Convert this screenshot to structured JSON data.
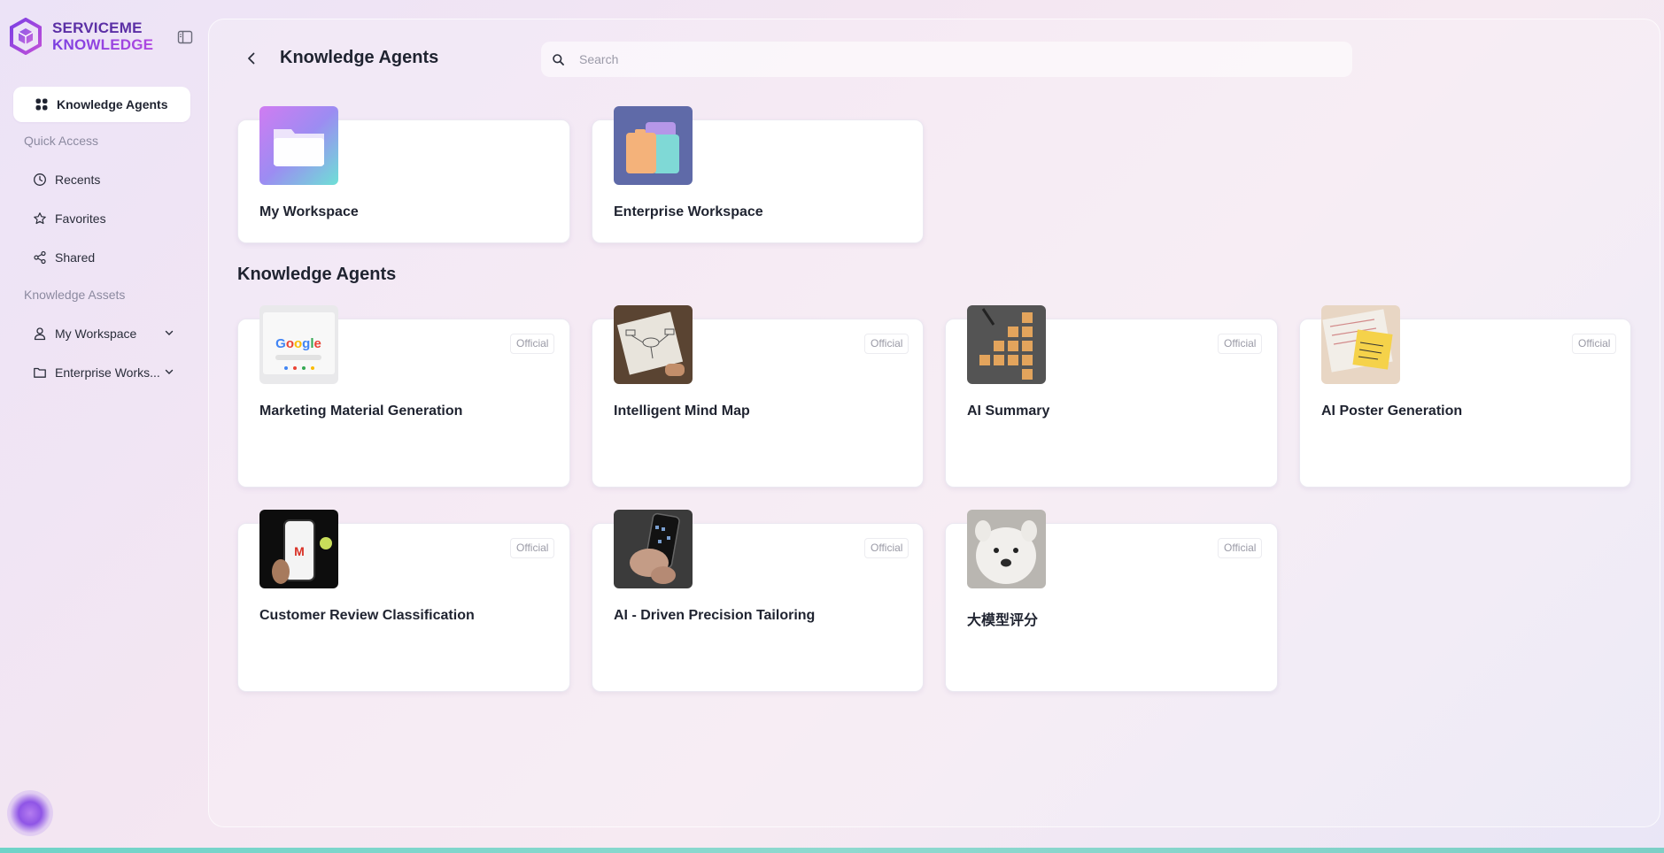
{
  "brand": {
    "line1": "SERVICEME",
    "line2": "KNOWLEDGE"
  },
  "sidebar": {
    "active": {
      "label": "Knowledge Agents",
      "icon": "grid-icon"
    },
    "quick_access_title": "Quick Access",
    "quick_access": [
      {
        "label": "Recents",
        "icon": "clock-icon"
      },
      {
        "label": "Favorites",
        "icon": "star-icon"
      },
      {
        "label": "Shared",
        "icon": "share-icon"
      }
    ],
    "assets_title": "Knowledge Assets",
    "assets": [
      {
        "label": "My Workspace",
        "icon": "user-icon"
      },
      {
        "label": "Enterprise Works...",
        "icon": "folder-icon"
      }
    ]
  },
  "header": {
    "title": "Knowledge Agents",
    "search_placeholder": "Search"
  },
  "workspaces": [
    {
      "title": "My Workspace"
    },
    {
      "title": "Enterprise Workspace"
    }
  ],
  "agents_heading": "Knowledge Agents",
  "badge_text": "Official",
  "agents": [
    {
      "title": "Marketing Material Generation",
      "badge": "Official"
    },
    {
      "title": "Intelligent Mind Map",
      "badge": "Official"
    },
    {
      "title": "AI Summary",
      "badge": "Official"
    },
    {
      "title": "AI Poster Generation",
      "badge": "Official"
    },
    {
      "title": "Customer Review Classification",
      "badge": "Official"
    },
    {
      "title": "AI - Driven Precision Tailoring",
      "badge": "Official"
    },
    {
      "title": "大模型评分",
      "badge": "Official"
    }
  ],
  "colors": {
    "brand": "#5b2fa5",
    "accent": "#8f55e6",
    "bottom_bar": "#7ccfc6"
  }
}
